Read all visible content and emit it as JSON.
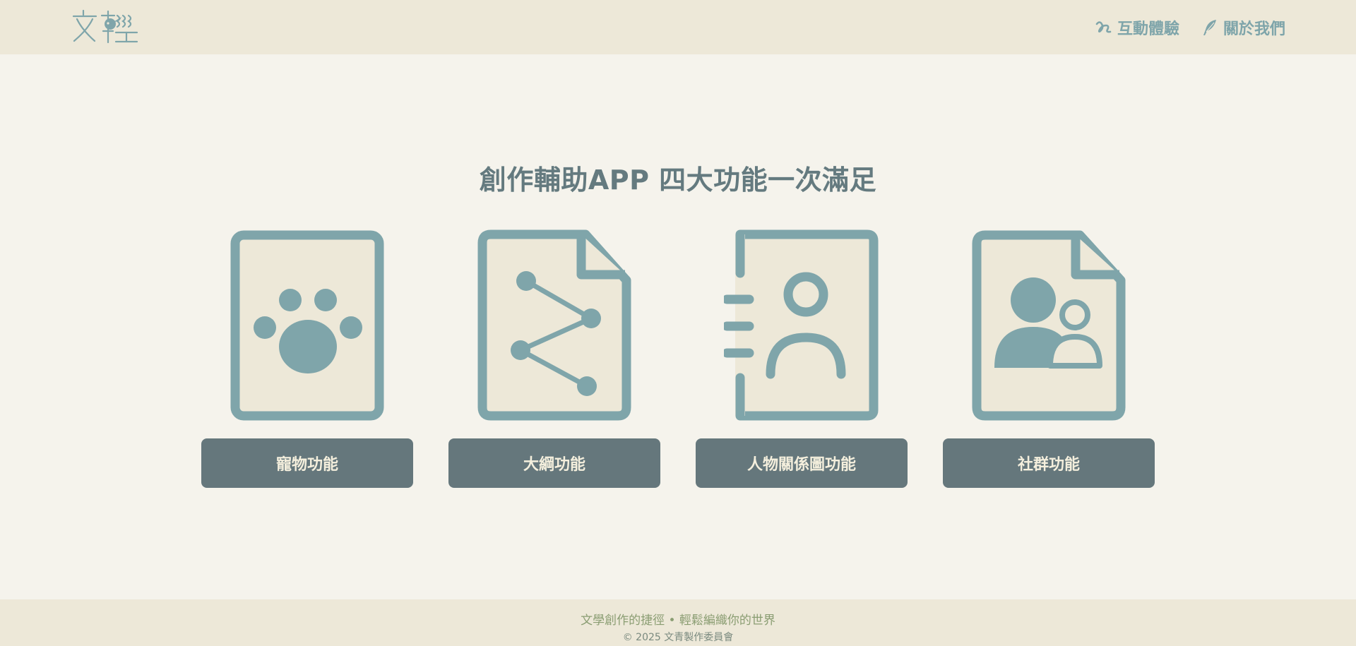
{
  "colors": {
    "accent": "#7fa5aa",
    "dark": "#65777c",
    "paper": "#ede8d8",
    "background": "#f5f3ec"
  },
  "header": {
    "logo_alt": "文輕",
    "nav": [
      {
        "label": "互動體驗",
        "icon": "swirl-icon"
      },
      {
        "label": "關於我們",
        "icon": "feather-icon"
      }
    ]
  },
  "main": {
    "headline": "創作輔助APP  四大功能一次滿足",
    "features": [
      {
        "label": "寵物功能",
        "icon": "paw-document-icon"
      },
      {
        "label": "大綱功能",
        "icon": "outline-document-icon"
      },
      {
        "label": "人物關係圖功能",
        "icon": "contact-book-icon"
      },
      {
        "label": "社群功能",
        "icon": "group-document-icon"
      }
    ]
  },
  "footer": {
    "slogan": "文學創作的捷徑 • 輕鬆編織你的世界",
    "copyright": "© 2025 文青製作委員會"
  }
}
